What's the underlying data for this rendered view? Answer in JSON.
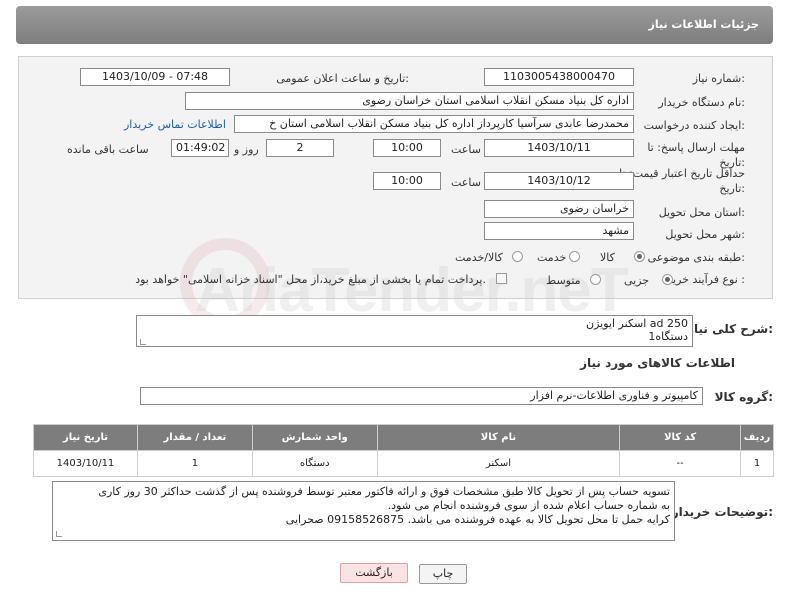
{
  "header": {
    "title": "جزئیات اطلاعات نیاز"
  },
  "form": {
    "need_number_label": "شماره نیاز:",
    "need_number": "1103005438000470",
    "announce_label": "تاریخ و ساعت اعلان عمومی:",
    "announce_value": "1403/10/09 - 07:48",
    "buyer_org_label": "نام دستگاه خریدار:",
    "buyer_org": "اداره کل بنیاد مسکن انقلاب اسلامی استان خراسان رضوی",
    "creator_label": "ایجاد کننده درخواست:",
    "creator": "محمدرضا عابدی سرآسیا کارپرداز اداره کل بنیاد مسکن انقلاب اسلامی استان خ",
    "contact_link": "اطلاعات تماس خریدار",
    "deadline_label": "مهلت ارسال پاسخ: تا تاریخ:",
    "deadline_date": "1403/10/11",
    "time_label": "ساعت",
    "deadline_time": "10:00",
    "days_value": "2",
    "days_and_label": "روز و",
    "remaining_time": "01:49:02",
    "remaining_label": "ساعت باقی مانده",
    "validity_label": "حداقل تاریخ اعتبار قیمت: تا تاریخ:",
    "validity_date": "1403/10/12",
    "validity_time": "10:00",
    "province_label": "استان محل تحویل:",
    "province": "خراسان رضوی",
    "city_label": "شهر محل تحویل:",
    "city": "مشهد",
    "category_label": "طبقه بندی موضوعی:",
    "category_options": [
      "کالا",
      "خدمت",
      "کالا/خدمت"
    ],
    "process_label": "نوع فرآیند خرید :",
    "process_options": [
      "جزیی",
      "متوسط"
    ],
    "payment_note": "پرداخت تمام یا بخشی از مبلغ خرید،از محل \"اسناد خزانه اسلامی\" خواهد بود."
  },
  "summary": {
    "label": "شرح کلی نیاز:",
    "line1": "اسکنر ایویژن ad 250",
    "line2": "1دستگاه"
  },
  "goods": {
    "section_title": "اطلاعات کالاهای مورد نیاز",
    "group_label": "گروه کالا:",
    "group_value": "کامپیوتر و فناوری اطلاعات-نرم افزار",
    "columns": [
      "ردیف",
      "کد کالا",
      "نام کالا",
      "واحد شمارش",
      "تعداد / مقدار",
      "تاریخ نیاز"
    ],
    "rows": [
      {
        "index": "1",
        "code": "--",
        "name": "اسکنر",
        "unit": "دستگاه",
        "qty": "1",
        "date": "1403/10/11"
      }
    ]
  },
  "buyer_notes": {
    "label": "توضیحات خریدار:",
    "line1": "تسویه حساب پس از تحویل کالا طبق مشخصات فوق و ارائه فاکتور معتبر توسط فروشنده پس از گذشت حداکثر 30 روز کاری",
    "line2": "به شماره حساب اعلام شده از سوی فروشنده انجام می شود.",
    "line3": "کرایه حمل تا محل تحویل کالا به عهده فروشنده می باشد. 09158526875 صحرایی"
  },
  "buttons": {
    "print": "چاپ",
    "back": "بازگشت"
  },
  "watermark": {
    "text": "AriaTender.neT"
  }
}
